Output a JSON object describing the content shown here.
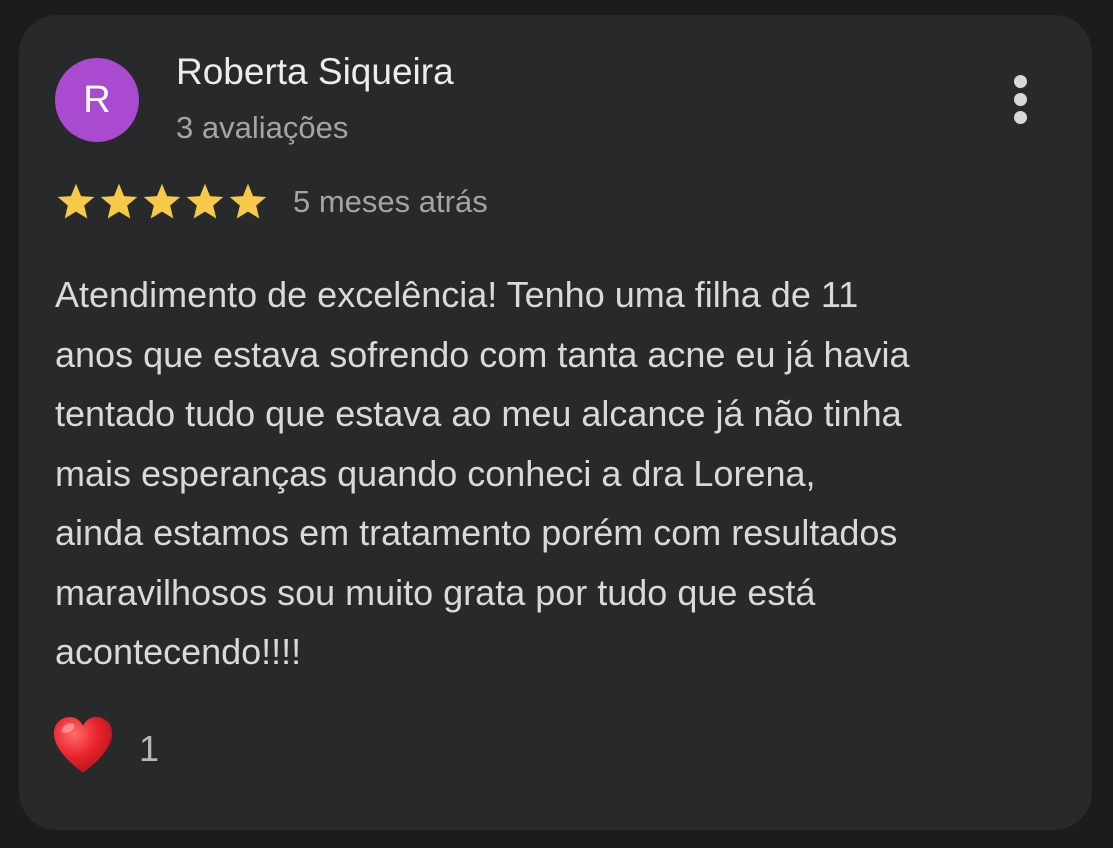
{
  "review": {
    "avatar_letter": "R",
    "avatar_color": "#a94ad0",
    "author": "Roberta Siqueira",
    "review_count": "3 avaliações",
    "menu_icon": "more-vert-icon",
    "rating": 5,
    "rating_max": 5,
    "star_color": "#f7c948",
    "time_ago": "5 meses atrás",
    "text_lines": [
      "Atendimento de excelência! Tenho uma filha de 11",
      "anos que estava sofrendo com tanta acne eu já havia",
      "tentado tudo que estava ao meu alcance já não tinha",
      "mais esperanças quando conheci a dra Lorena,",
      "ainda estamos em tratamento porém com resultados",
      "maravilhosos sou muito grata por tudo que está",
      "acontecendo!!!!"
    ],
    "reaction_icon": "heart-icon",
    "reaction_count": "1"
  }
}
